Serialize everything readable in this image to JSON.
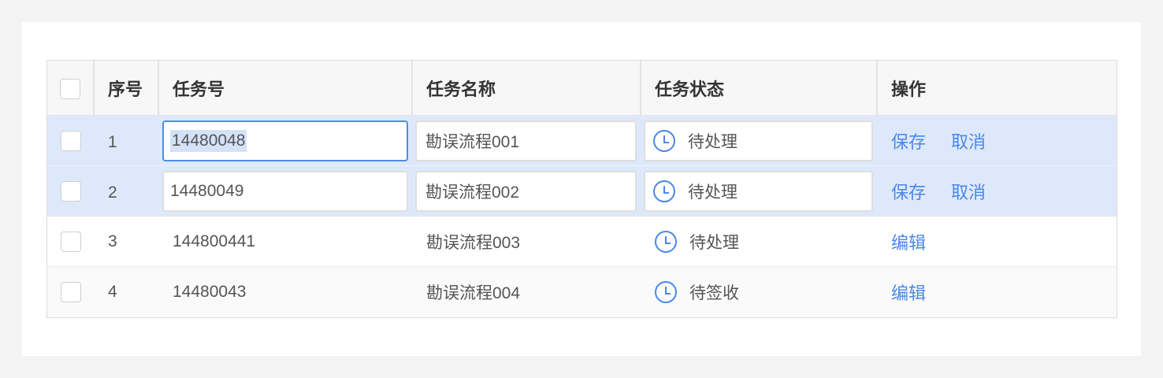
{
  "table": {
    "headers": {
      "no": "序号",
      "task_id": "任务号",
      "task_name": "任务名称",
      "task_status": "任务状态",
      "ops": "操作"
    },
    "rows": [
      {
        "no": "1",
        "task_id": "14480048",
        "task_name": "勘误流程001",
        "status": "待处理",
        "ops": [
          "保存",
          "取消"
        ]
      },
      {
        "no": "2",
        "task_id": "14480049",
        "task_name": "勘误流程002",
        "status": "待处理",
        "ops": [
          "保存",
          "取消"
        ]
      },
      {
        "no": "3",
        "task_id": "144800441",
        "task_name": "勘误流程003",
        "status": "待处理",
        "ops": [
          "编辑"
        ]
      },
      {
        "no": "4",
        "task_id": "14480043",
        "task_name": "勘误流程004",
        "status": "待签收",
        "ops": [
          "编辑"
        ]
      }
    ]
  },
  "colors": {
    "accent": "#4a87e8",
    "editing_row_bg": "#dde9fb",
    "page_bg": "#f3f3f3"
  },
  "icons": {
    "status": "clock-icon"
  }
}
